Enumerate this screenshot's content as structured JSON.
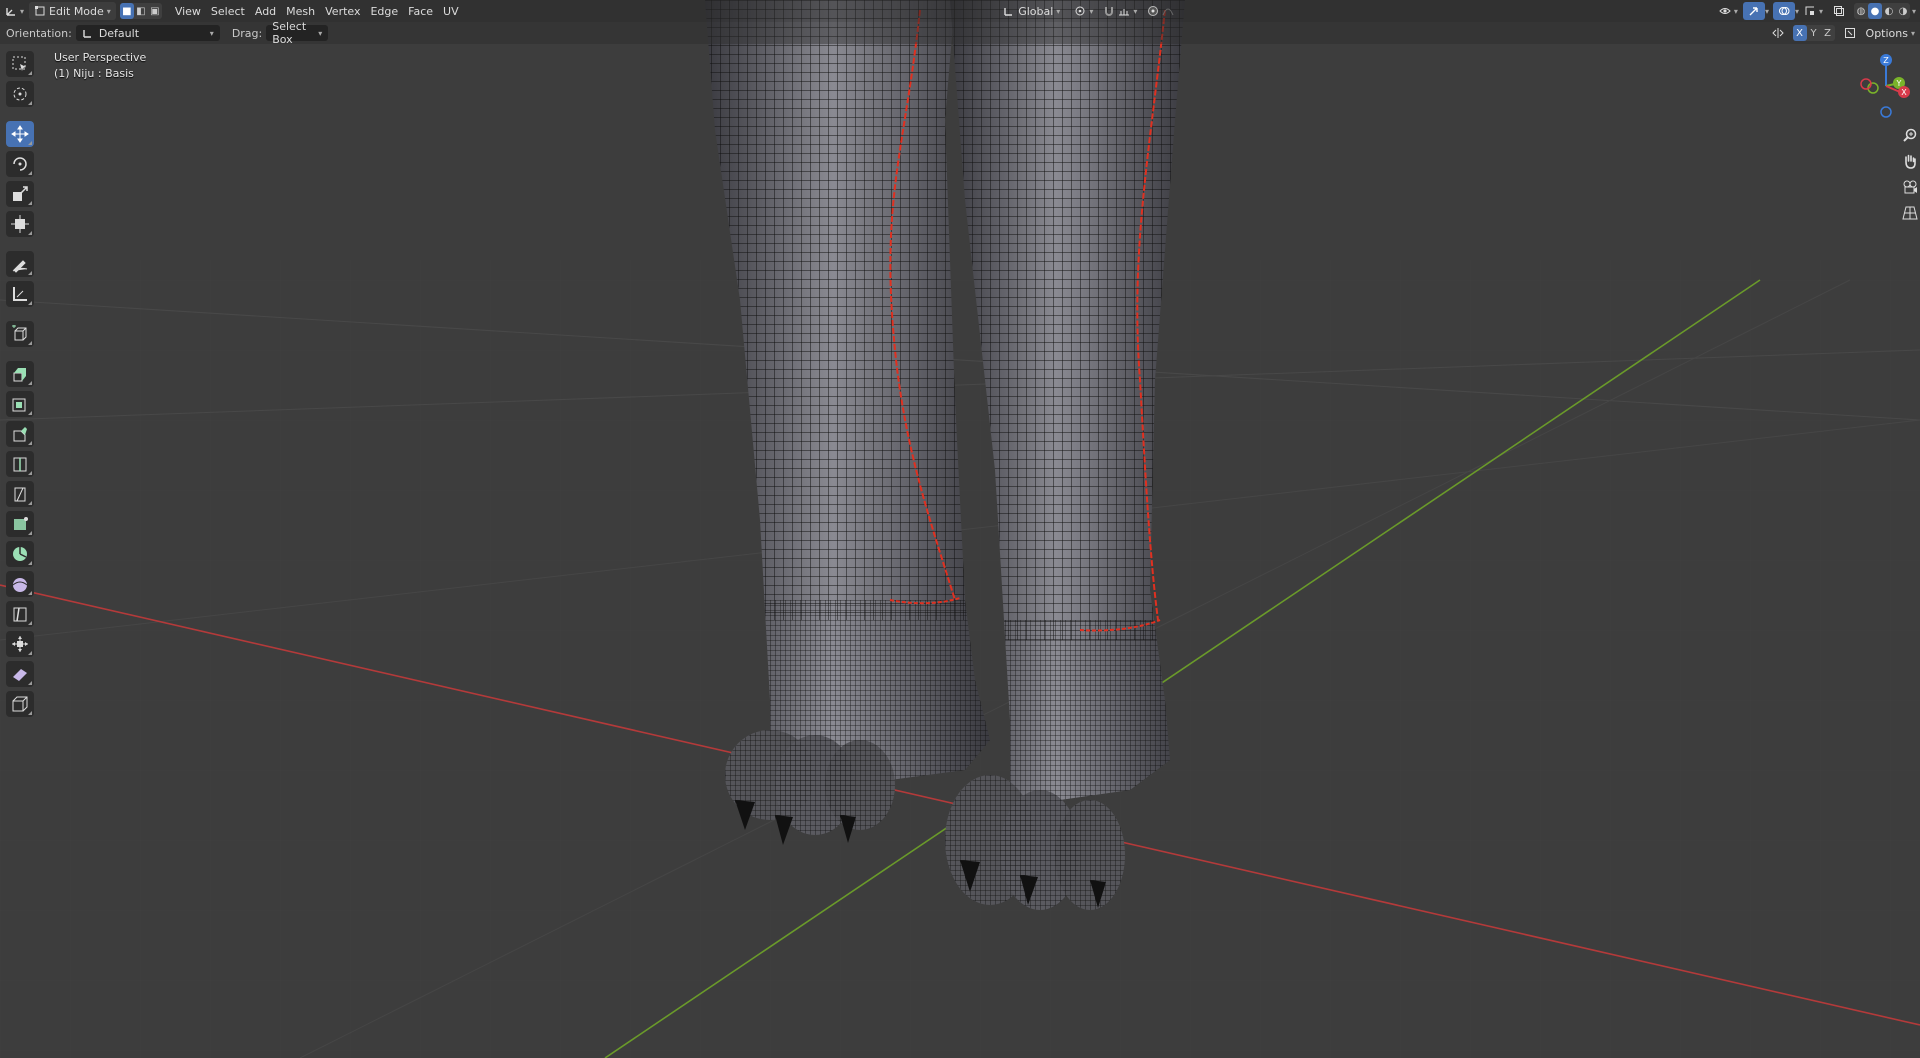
{
  "header": {
    "mode_label": "Edit Mode",
    "menus": [
      "View",
      "Select",
      "Add",
      "Mesh",
      "Vertex",
      "Edge",
      "Face",
      "UV"
    ],
    "transform_orientation": "Global"
  },
  "tool_settings": {
    "orientation_label": "Orientation:",
    "orientation_value": "Default",
    "drag_label": "Drag:",
    "drag_value": "Select Box",
    "mirror_axes": [
      "X",
      "Y",
      "Z"
    ],
    "options_label": "Options"
  },
  "viewport": {
    "view_name": "User Perspective",
    "object_info": "(1) Niju : Basis"
  },
  "gizmo": {
    "axes": [
      "Z",
      "Y",
      "X"
    ]
  },
  "colors": {
    "accent": "#4772b3",
    "background": "#3d3d3d",
    "x_axis": "#b43a3a",
    "y_axis": "#6a9a2a",
    "seam": "#e03020"
  }
}
